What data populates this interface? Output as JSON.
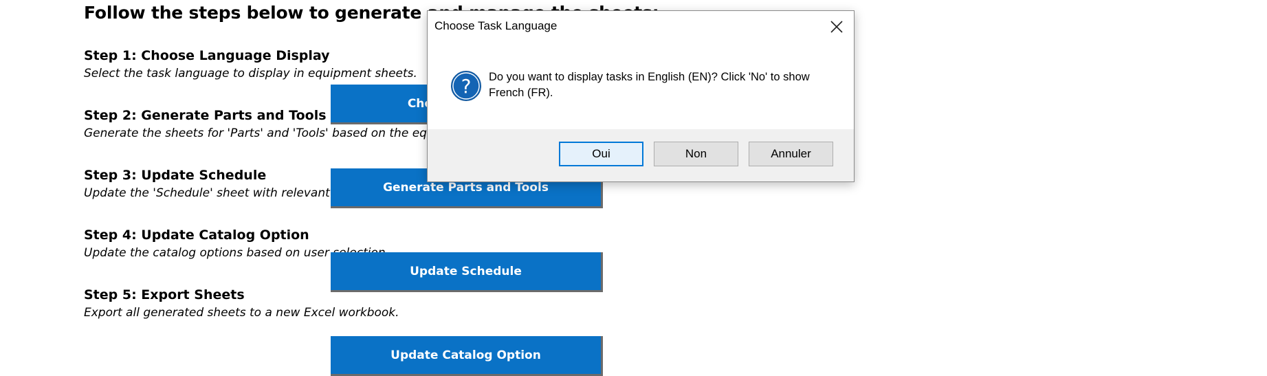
{
  "sheet": {
    "heading": "Follow the steps below to generate and manage the sheets:",
    "steps": [
      {
        "title": "Step 1: Choose Language Display",
        "desc": "Select the task language to display in equipment sheets."
      },
      {
        "title": "Step 2: Generate Parts and Tools",
        "desc": "Generate the sheets for 'Parts' and 'Tools' based on the equipment."
      },
      {
        "title": "Step 3: Update Schedule",
        "desc": "Update the 'Schedule' sheet with relevant data."
      },
      {
        "title": "Step 4: Update Catalog Option",
        "desc": "Update the catalog options based on user selection."
      },
      {
        "title": "Step 5: Export Sheets",
        "desc": "Export all generated sheets to a new Excel workbook."
      }
    ],
    "buttons": [
      {
        "label": "Choose Language"
      },
      {
        "label": "Generate Parts and Tools"
      },
      {
        "label": "Update Schedule"
      },
      {
        "label": "Update Catalog Option"
      }
    ]
  },
  "dialog": {
    "title": "Choose Task Language",
    "message": "Do you want to display tasks in English (EN)? Click 'No' to show French (FR).",
    "icon": "question-icon",
    "buttons": {
      "yes": "Oui",
      "no": "Non",
      "cancel": "Annuler"
    },
    "accent_color": "#0078d7"
  },
  "colors": {
    "macro_button": "#0a72c6",
    "icon": "#1464b4"
  }
}
